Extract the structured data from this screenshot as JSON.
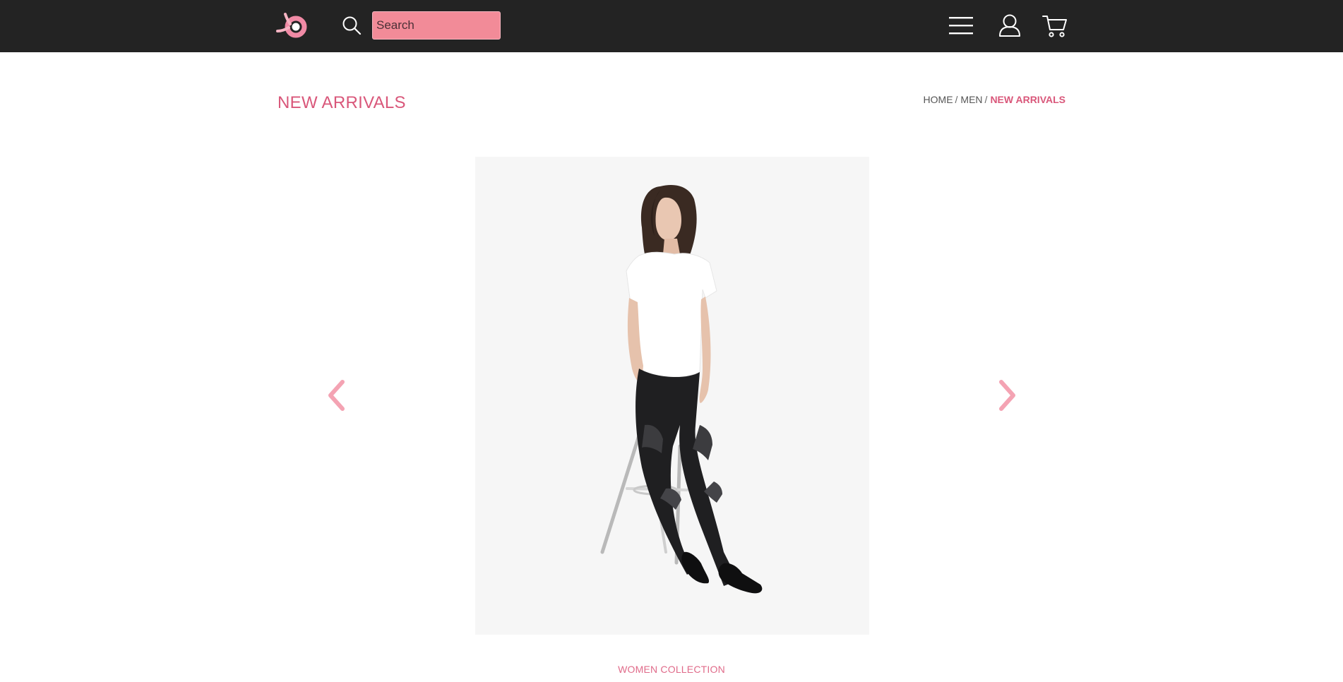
{
  "header": {
    "logo_icon": "brand-logo-icon",
    "search": {
      "icon": "search-icon",
      "placeholder": "Search",
      "value": ""
    },
    "menu_icon": "hamburger-menu-icon",
    "account_icon": "user-icon",
    "cart_icon": "cart-icon"
  },
  "page": {
    "title": "NEW ARRIVALS",
    "breadcrumb": [
      {
        "label": "HOME"
      },
      {
        "label": "MEN"
      },
      {
        "label": "NEW ARRIVALS"
      }
    ],
    "breadcrumb_separator": "/"
  },
  "carousel": {
    "prev_icon": "chevron-left-icon",
    "next_icon": "chevron-right-icon",
    "caption": "WOMEN COLLECTION"
  },
  "colors": {
    "header_bg": "#232323",
    "accent": "#d9577a",
    "search_bg": "#f28b98",
    "arrow": "#f4a3b3",
    "image_bg": "#f6f6f6"
  }
}
